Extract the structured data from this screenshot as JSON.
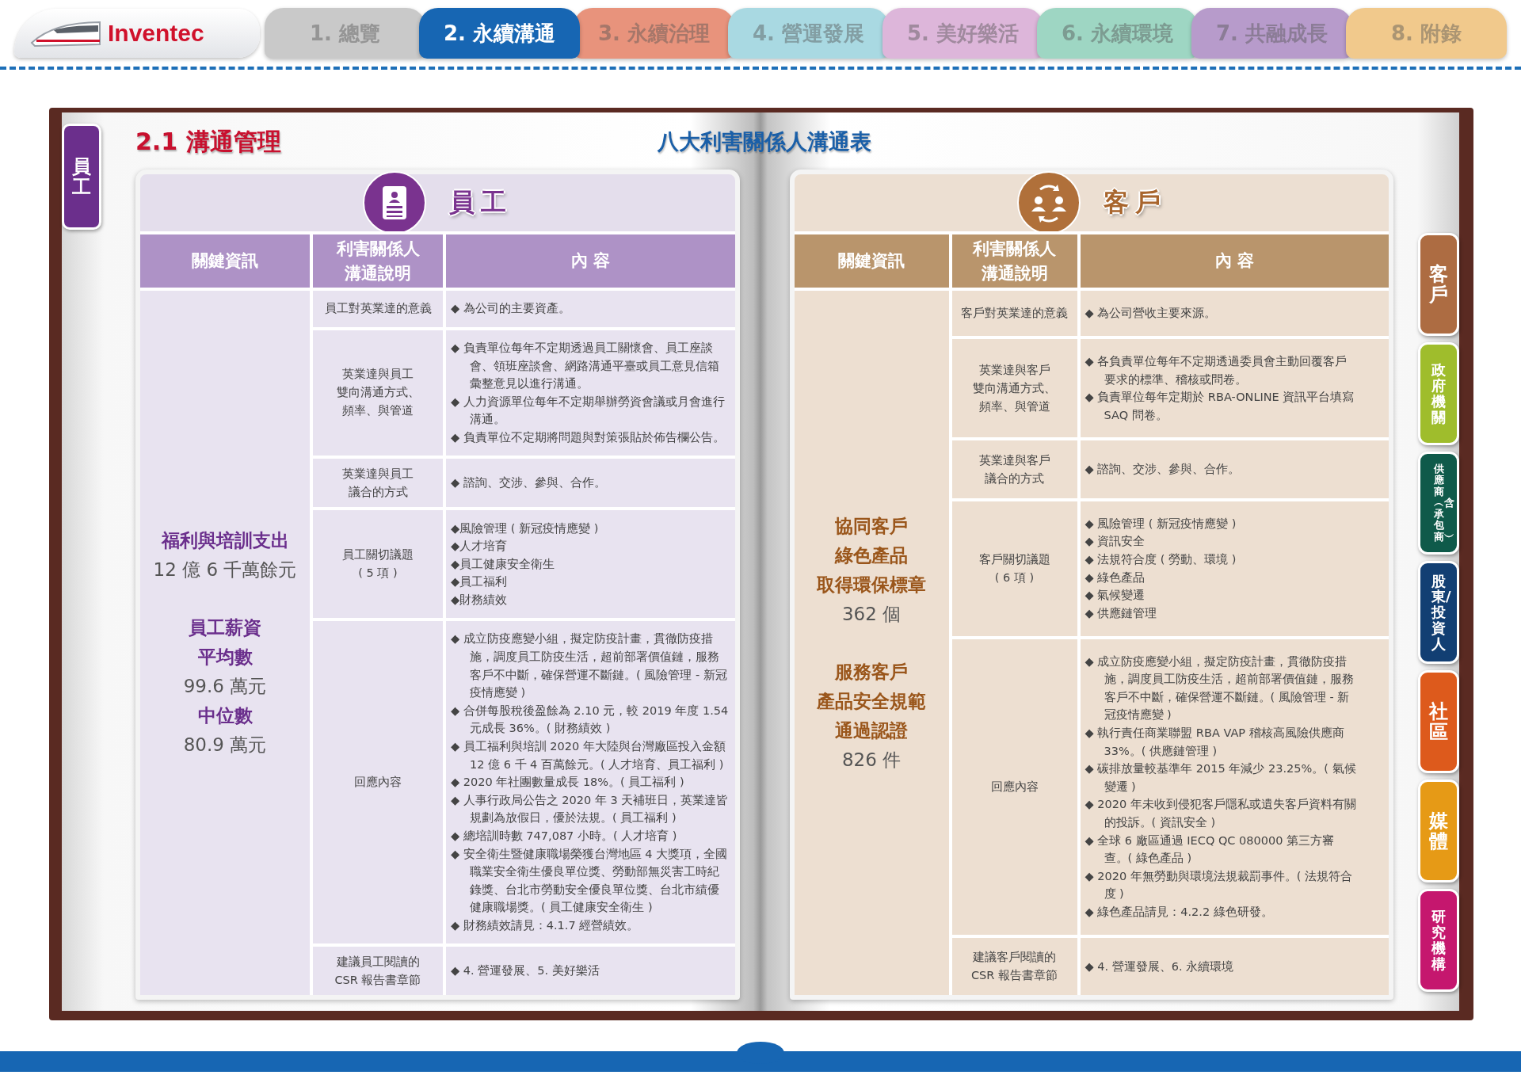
{
  "logo": {
    "text": "Inventec"
  },
  "nav": {
    "tabs": [
      {
        "label": "1. 總覽",
        "color": "#c9c9c9",
        "selected": false
      },
      {
        "label": "2. 永續溝通",
        "color": "#1766b3",
        "selected": true
      },
      {
        "label": "3. 永續治理",
        "color": "#e8937c",
        "selected": false
      },
      {
        "label": "4. 營運發展",
        "color": "#a9d9e2",
        "selected": false
      },
      {
        "label": "5. 美好樂活",
        "color": "#ddb6da",
        "selected": false
      },
      {
        "label": "6. 永續環境",
        "color": "#9ed6c3",
        "selected": false
      },
      {
        "label": "7. 共融成長",
        "color": "#b79bcb",
        "selected": false
      },
      {
        "label": "8. 附錄",
        "color": "#f1c98c",
        "selected": false
      }
    ]
  },
  "page_title": "2.1 溝通管理",
  "table_title": "八大利害關係人溝通表",
  "left_tab": {
    "label": "員工",
    "color": "#6b2f8c"
  },
  "side_tabs": [
    {
      "label": "客戶",
      "color": "#ad6c42"
    },
    {
      "label": "政府機關",
      "color": "#9fbd2c"
    },
    {
      "label": "供應商︵含承包商︶",
      "color": "#0f5a4a"
    },
    {
      "label": "股東/投資人",
      "color": "#123f73"
    },
    {
      "label": "社區",
      "color": "#dd5a1c"
    },
    {
      "label": "媒體",
      "color": "#e69a16"
    },
    {
      "label": "研究機構",
      "color": "#c5176e"
    }
  ],
  "panels": [
    {
      "kind": "employee",
      "title": "員工",
      "columns": [
        "關鍵資訊",
        "利害關係人溝通說明",
        "內 容"
      ],
      "key_info": [
        [
          {
            "kind": "heading",
            "text": "福利與培訓支出"
          },
          {
            "kind": "value",
            "text": "12 億 6 千萬餘元"
          }
        ],
        [
          {
            "kind": "heading",
            "text": "員工薪資"
          },
          {
            "kind": "heading",
            "text": "平均數"
          },
          {
            "kind": "value",
            "text": "99.6 萬元"
          },
          {
            "kind": "heading",
            "text": "中位數"
          },
          {
            "kind": "value",
            "text": "80.9 萬元"
          }
        ]
      ],
      "rows": [
        {
          "topic": [
            "員工對英業達的意義"
          ],
          "content": [
            "◆ 為公司的主要資產。"
          ]
        },
        {
          "topic": [
            "英業達與員工",
            "雙向溝通方式、",
            "頻率、與管道"
          ],
          "content": [
            "◆ 負責單位每年不定期透過員工關懷會、員工座談會、領班座談會、網路溝通平臺或員工意見信箱彙整意見以進行溝通。",
            "◆ 人力資源單位每年不定期舉辦勞資會議或月會進行溝通。",
            "◆ 負責單位不定期將問題與對策張貼於佈告欄公告。"
          ]
        },
        {
          "topic": [
            "英業達與員工",
            "議合的方式"
          ],
          "content": [
            "◆ 諮詢、交涉、參與、合作。"
          ]
        },
        {
          "topic": [
            "員工關切議題",
            "( 5 項 )"
          ],
          "content": [
            "◆風險管理 ( 新冠疫情應變 )",
            "◆人才培育",
            "◆員工健康安全衛生",
            "◆員工福利",
            "◆財務績效"
          ]
        },
        {
          "topic": [
            "回應內容"
          ],
          "content": [
            "◆ 成立防疫應變小組，擬定防疫計畫，貫徹防疫措施，調度員工防疫生活，超前部署價值鏈，服務客戶不中斷，確保營運不斷鏈。( 風險管理 - 新冠疫情應變 )",
            "◆ 合併每股稅後盈餘為 2.10 元，較 2019 年度 1.54 元成長 36%。( 財務績效 )",
            "◆ 員工福利與培訓 2020 年大陸與台灣廠區投入金額 12 億 6 千 4 百萬餘元。( 人才培育、員工福利 )",
            "◆ 2020 年社團數量成長 18%。( 員工福利 )",
            "◆ 人事行政局公告之 2020 年 3 天補班日，英業達皆規劃為放假日，優於法規。( 員工福利 )",
            "◆ 總培訓時數 747,087 小時。( 人才培育 )",
            "◆ 安全衛生暨健康職場榮獲台灣地區 4 大獎項，全國職業安全衛生優良單位獎、勞動部無災害工時紀錄獎、台北市勞動安全優良單位獎、台北市績優健康職場獎。( 員工健康安全衛生 )",
            "◆ 財務績效請見：4.1.7 經營績效。"
          ]
        },
        {
          "topic": [
            "建議員工閱讀的",
            "CSR 報告書章節"
          ],
          "content": [
            "◆ 4. 營運發展、5. 美好樂活"
          ]
        }
      ]
    },
    {
      "kind": "customer",
      "title": "客戶",
      "columns": [
        "關鍵資訊",
        "利害關係人溝通說明",
        "內 容"
      ],
      "key_info": [
        [
          {
            "kind": "heading",
            "text": "協同客戶"
          },
          {
            "kind": "heading",
            "text": "綠色產品"
          },
          {
            "kind": "heading",
            "text": "取得環保標章"
          },
          {
            "kind": "value",
            "text": "362 個"
          }
        ],
        [
          {
            "kind": "heading",
            "text": "服務客戶"
          },
          {
            "kind": "heading",
            "text": "產品安全規範"
          },
          {
            "kind": "heading",
            "text": "通過認證"
          },
          {
            "kind": "value",
            "text": "826 件"
          }
        ]
      ],
      "rows": [
        {
          "topic": [
            "客戶對英業達的意義"
          ],
          "content": [
            "◆ 為公司營收主要來源。"
          ]
        },
        {
          "topic": [
            "英業達與客戶",
            "雙向溝通方式、",
            "頻率、與管道"
          ],
          "content": [
            "◆ 各負責單位每年不定期透過委員會主動回覆客戶要求的標準、稽核或問卷。",
            "◆ 負責單位每年定期於 RBA-ONLINE 資訊平台填寫 SAQ 問卷。"
          ]
        },
        {
          "topic": [
            "英業達與客戶",
            "議合的方式"
          ],
          "content": [
            "◆ 諮詢、交涉、參與、合作。"
          ]
        },
        {
          "topic": [
            "客戶關切議題",
            "( 6 項 )"
          ],
          "content": [
            "◆ 風險管理 ( 新冠疫情應變 )",
            "◆ 資訊安全",
            "◆ 法規符合度 ( 勞動、環境 )",
            "◆ 綠色產品",
            "◆ 氣候變遷",
            "◆ 供應鏈管理"
          ]
        },
        {
          "topic": [
            "回應內容"
          ],
          "content": [
            "◆ 成立防疫應變小組，擬定防疫計畫，貫徹防疫措施，調度員工防疫生活，超前部署價值鏈，服務客戶不中斷，確保營運不斷鏈。( 風險管理 - 新冠疫情應變 )",
            "◆ 執行責任商業聯盟 RBA VAP 稽核高風險供應商 33%。( 供應鏈管理 )",
            "◆ 碳排放量較基準年 2015 年減少 23.25%。( 氣候變遷 )",
            "◆ 2020 年未收到侵犯客戶隱私或遺失客戶資料有關的投訴。( 資訊安全 )",
            "◆ 全球 6 廠區通過 IECQ QC 080000 第三方審查。( 綠色產品 )",
            "◆ 2020 年無勞動與環境法規裁罰事件。( 法規符合度 )",
            "◆ 綠色產品請見：4.2.2 綠色研發。"
          ]
        },
        {
          "topic": [
            "建議客戶閱讀的",
            "CSR 報告書章節"
          ],
          "content": [
            "◆ 4. 營運發展、6. 永續環境"
          ]
        }
      ]
    }
  ]
}
